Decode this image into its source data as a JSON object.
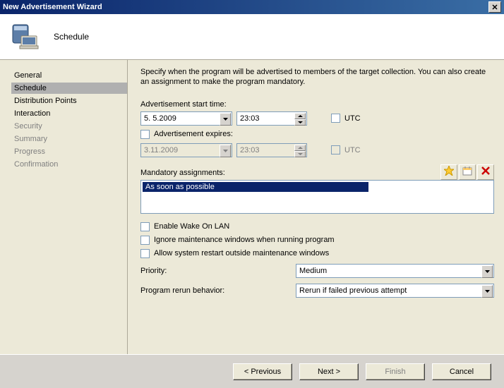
{
  "title": "New Advertisement Wizard",
  "header": {
    "title": "Schedule"
  },
  "nav": {
    "items": [
      {
        "label": "General",
        "muted": false,
        "active": false
      },
      {
        "label": "Schedule",
        "muted": false,
        "active": true
      },
      {
        "label": "Distribution Points",
        "muted": false,
        "active": false
      },
      {
        "label": "Interaction",
        "muted": false,
        "active": false
      },
      {
        "label": "Security",
        "muted": true,
        "active": false
      },
      {
        "label": "Summary",
        "muted": true,
        "active": false
      },
      {
        "label": "Progress",
        "muted": true,
        "active": false
      },
      {
        "label": "Confirmation",
        "muted": true,
        "active": false
      }
    ]
  },
  "main": {
    "description": "Specify when the program will be advertised to members of the target collection. You can also create an assignment to make the program mandatory.",
    "start": {
      "label": "Advertisement start time:",
      "date": "5.  5.2009",
      "time": "23:03",
      "utc_label": "UTC"
    },
    "expire": {
      "checkbox_label": "Advertisement expires:",
      "date": "3.11.2009",
      "time": "23:03",
      "utc_label": "UTC"
    },
    "assignments": {
      "label": "Mandatory assignments:",
      "items": [
        "As soon as possible"
      ]
    },
    "checks": {
      "wol": "Enable Wake On LAN",
      "ignore": "Ignore maintenance windows when running program",
      "restart": "Allow system restart outside maintenance windows"
    },
    "priority": {
      "label": "Priority:",
      "value": "Medium"
    },
    "rerun": {
      "label": "Program rerun behavior:",
      "value": "Rerun if failed previous attempt"
    }
  },
  "footer": {
    "previous": "< Previous",
    "next": "Next >",
    "finish": "Finish",
    "cancel": "Cancel"
  }
}
